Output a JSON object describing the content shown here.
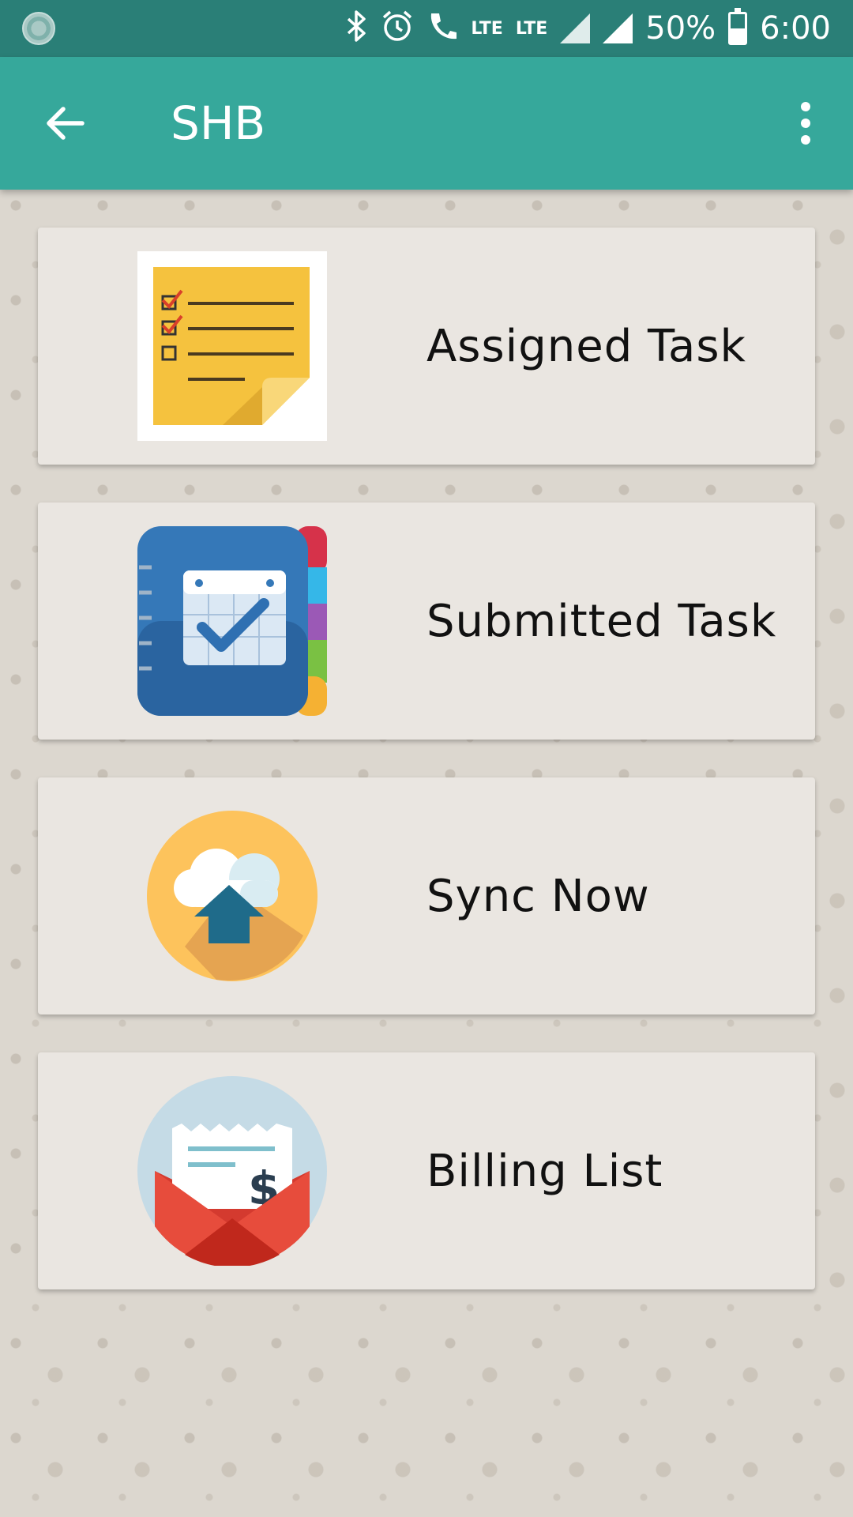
{
  "status_bar": {
    "lte_1": "LTE",
    "lte_2": "LTE",
    "battery_percent": "50%",
    "time": "6:00"
  },
  "app_bar": {
    "title": "SHB"
  },
  "menu": [
    {
      "label": "Assigned Task",
      "icon": "task-list-icon"
    },
    {
      "label": "Submitted Task",
      "icon": "calendar-check-icon"
    },
    {
      "label": "Sync Now",
      "icon": "cloud-upload-icon"
    },
    {
      "label": "Billing List",
      "icon": "bill-envelope-icon"
    }
  ],
  "colors": {
    "status_bar": "#2a7f77",
    "app_bar": "#36a89b",
    "card": "#eae6e1"
  }
}
